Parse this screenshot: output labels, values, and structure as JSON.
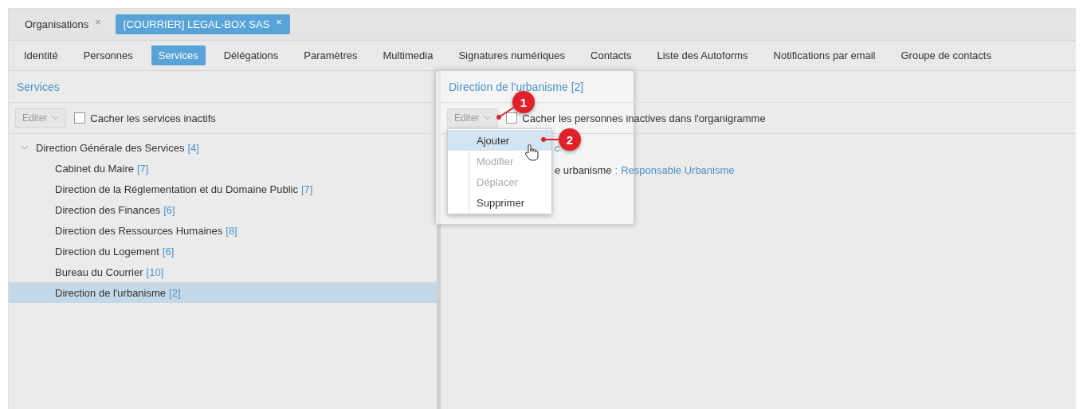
{
  "tabs": [
    {
      "label": "Organisations",
      "close": "×",
      "selected": false
    },
    {
      "label": "[COURRIER] LEGAL-BOX SAS",
      "close": "×",
      "selected": true
    }
  ],
  "nav": [
    {
      "label": "Identité",
      "selected": false
    },
    {
      "label": "Personnes",
      "selected": false
    },
    {
      "label": "Services",
      "selected": true
    },
    {
      "label": "Délégations",
      "selected": false
    },
    {
      "label": "Paramètres",
      "selected": false
    },
    {
      "label": "Multimedia",
      "selected": false
    },
    {
      "label": "Signatures numériques",
      "selected": false
    },
    {
      "label": "Contacts",
      "selected": false
    },
    {
      "label": "Liste des Autoforms",
      "selected": false
    },
    {
      "label": "Notifications par email",
      "selected": false
    },
    {
      "label": "Groupe de contacts",
      "selected": false
    }
  ],
  "left_panel": {
    "title": "Services",
    "edit_button": "Editer",
    "checkbox": {
      "label": "Cacher les services inactifs",
      "checked": false
    },
    "tree": [
      {
        "label": "Direction Générale des Services",
        "count": "[4]",
        "expanded": true,
        "selected": false,
        "children": [
          {
            "label": "Cabinet du Maire",
            "count": "[7]",
            "selected": false
          },
          {
            "label": "Direction de la Réglementation et du Domaine Public",
            "count": "[7]",
            "selected": false
          },
          {
            "label": "Direction des Finances",
            "count": "[6]",
            "selected": false
          },
          {
            "label": "Direction des Ressources Humaines",
            "count": "[8]",
            "selected": false
          },
          {
            "label": "Direction du Logement",
            "count": "[6]",
            "selected": false
          },
          {
            "label": "Bureau du Courrier",
            "count": "[10]",
            "selected": false
          },
          {
            "label": "Direction de l'urbanisme",
            "count": "[2]",
            "selected": true
          }
        ]
      }
    ]
  },
  "right_panel": {
    "title": "Direction de l'urbanisme [2]",
    "edit_button": "Editer",
    "checkbox": {
      "label": "Cacher les personnes inactives dans l'organigramme",
      "checked": false
    },
    "menu": [
      {
        "label": "Ajouter",
        "disabled": false,
        "selected": true
      },
      {
        "label": "Modifier",
        "disabled": true,
        "selected": false
      },
      {
        "label": "Déplacer",
        "disabled": true,
        "selected": false
      },
      {
        "label": "Supprimer",
        "disabled": false,
        "selected": false
      }
    ],
    "partial_link": "c",
    "detail": {
      "label": "e urbanisme",
      "separator": ":",
      "value": "Responsable Urbanisme"
    }
  },
  "annotations": [
    {
      "number": "1"
    },
    {
      "number": "2"
    }
  ]
}
